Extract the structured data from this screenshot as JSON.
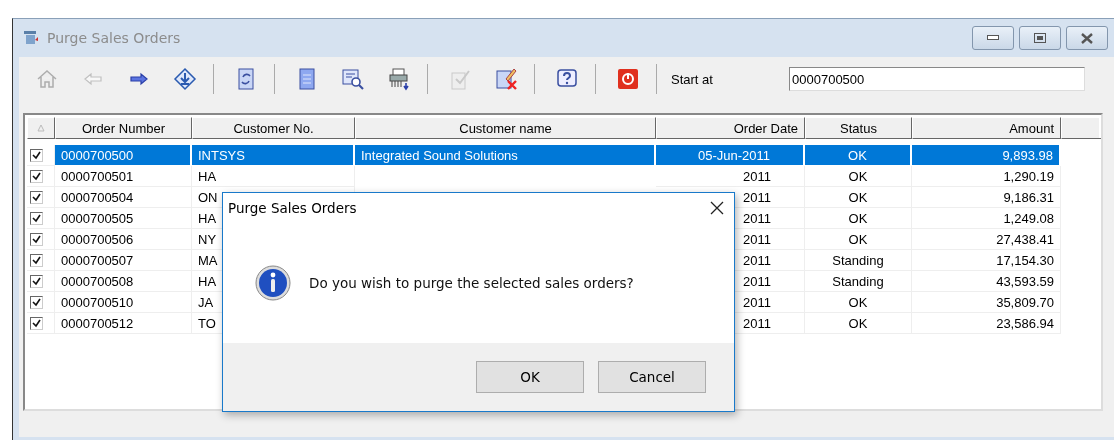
{
  "window": {
    "title": "Purge Sales Orders"
  },
  "toolbar": {
    "groups": [
      [
        {
          "kind": "home",
          "disabled": true
        },
        {
          "kind": "back",
          "disabled": true
        },
        {
          "kind": "forward",
          "disabled": false
        },
        {
          "kind": "jump",
          "disabled": false
        }
      ],
      [
        {
          "kind": "refresh",
          "disabled": false
        }
      ],
      [
        {
          "kind": "document",
          "disabled": false
        },
        {
          "kind": "preview",
          "disabled": false
        },
        {
          "kind": "shredder",
          "disabled": false
        }
      ],
      [
        {
          "kind": "approve",
          "disabled": true
        },
        {
          "kind": "delete-edit",
          "disabled": false
        }
      ],
      [
        {
          "kind": "help",
          "disabled": false
        }
      ],
      [
        {
          "kind": "power",
          "disabled": false
        }
      ]
    ],
    "start_at": {
      "label": "Start at",
      "value": "0000700500"
    }
  },
  "table": {
    "columns": [
      "Order Number",
      "Customer No.",
      "Customer name",
      "Order Date",
      "Status",
      "Amount"
    ],
    "rows": [
      {
        "checked": true,
        "selected": true,
        "order_number": "0000700500",
        "customer_no": "INTSYS",
        "customer_name": "Integrated Sound Solutions",
        "order_date": "05-Jun-2011",
        "status": "OK",
        "amount": "9,893.98"
      },
      {
        "checked": true,
        "selected": false,
        "order_number": "0000700501",
        "customer_no": "HA",
        "order_date": "2011",
        "status": "OK",
        "amount": "1,290.19"
      },
      {
        "checked": true,
        "selected": false,
        "order_number": "0000700504",
        "customer_no": "ON",
        "order_date": "2011",
        "status": "OK",
        "amount": "9,186.31"
      },
      {
        "checked": true,
        "selected": false,
        "order_number": "0000700505",
        "customer_no": "HA",
        "order_date": "2011",
        "status": "OK",
        "amount": "1,249.08"
      },
      {
        "checked": true,
        "selected": false,
        "order_number": "0000700506",
        "customer_no": "NY",
        "order_date": "2011",
        "status": "OK",
        "amount": "27,438.41"
      },
      {
        "checked": true,
        "selected": false,
        "order_number": "0000700507",
        "customer_no": "MA",
        "order_date": "2011",
        "status": "Standing",
        "amount": "17,154.30"
      },
      {
        "checked": true,
        "selected": false,
        "order_number": "0000700508",
        "customer_no": "HA",
        "order_date": "2011",
        "status": "Standing",
        "amount": "43,593.59"
      },
      {
        "checked": true,
        "selected": false,
        "order_number": "0000700510",
        "customer_no": "JA",
        "order_date": "2011",
        "status": "OK",
        "amount": "35,809.70"
      },
      {
        "checked": true,
        "selected": false,
        "order_number": "0000700512",
        "customer_no": "TO",
        "order_date": "2011",
        "status": "OK",
        "amount": "23,586.94"
      }
    ]
  },
  "dialog": {
    "title": "Purge Sales Orders",
    "message": "Do you wish to purge the selected sales orders?",
    "buttons": [
      "OK",
      "Cancel"
    ]
  }
}
